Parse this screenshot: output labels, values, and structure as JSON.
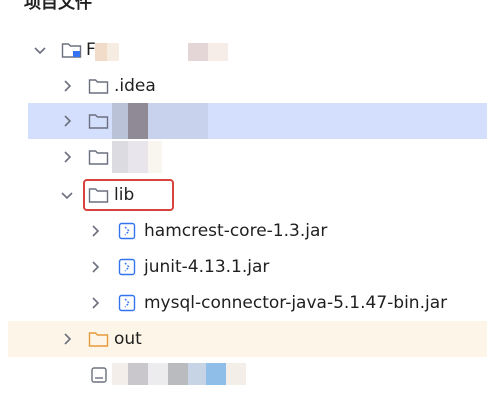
{
  "header": {
    "title": "项目文件"
  },
  "tree": {
    "root": {
      "label": "F"
    },
    "idea": {
      "label": ".idea"
    },
    "lib": {
      "label": "lib"
    },
    "jars": [
      {
        "label": "hamcrest-core-1.3.jar"
      },
      {
        "label": "junit-4.13.1.jar"
      },
      {
        "label": "mysql-connector-java-5.1.47-bin.jar"
      }
    ],
    "out": {
      "label": "out"
    }
  },
  "colors": {
    "selection": "#d4dffd",
    "out_row": "#fdf6e8",
    "highlight": "#d8433d",
    "jar_icon": "#3574f0"
  },
  "icons": {
    "folder": "folder-icon",
    "jar": "jar-file-icon",
    "chevron_right": "chevron-right-icon",
    "chevron_down": "chevron-down-icon"
  }
}
